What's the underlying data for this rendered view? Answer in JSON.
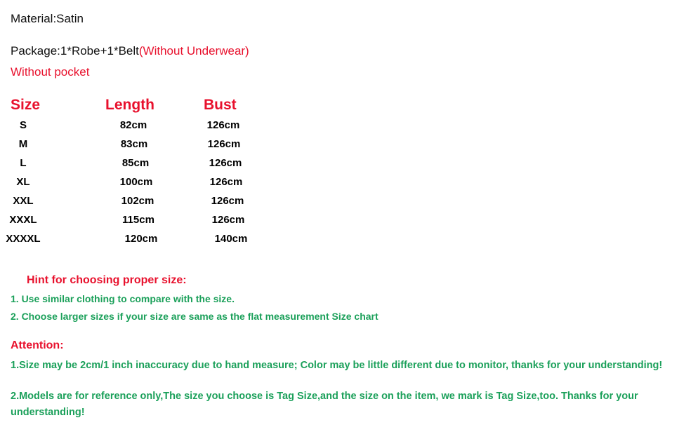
{
  "product_info": {
    "material_label": "Material:",
    "material_value": "Satin",
    "material_line": "Material:Satin",
    "package_main": "Package:1*Robe+1*Belt",
    "package_note": "(Without Underwear)",
    "pocket_note": "Without pocket"
  },
  "size_chart": {
    "headers": {
      "size": "Size",
      "length": "Length",
      "bust": "Bust"
    },
    "rows": [
      {
        "size": "S",
        "length": "82cm",
        "bust": "126cm"
      },
      {
        "size": "M",
        "length": "83cm",
        "bust": "126cm"
      },
      {
        "size": "L",
        "length": "85cm",
        "bust": "126cm"
      },
      {
        "size": "XL",
        "length": "100cm",
        "bust": "126cm"
      },
      {
        "size": "XXL",
        "length": "102cm",
        "bust": "126cm"
      },
      {
        "size": "XXXL",
        "length": "115cm",
        "bust": "126cm"
      },
      {
        "size": "XXXXL",
        "length": "120cm",
        "bust": "140cm"
      }
    ]
  },
  "hint": {
    "title": "Hint for choosing proper size:",
    "items": [
      "1. Use similar clothing to compare with the size.",
      "2. Choose larger sizes if your size are same as the flat measurement Size chart"
    ]
  },
  "attention": {
    "title": "Attention:",
    "items": [
      "1.Size may be 2cm/1 inch inaccuracy due to hand measure; Color may be little different   due to monitor, thanks for your understanding!",
      "2.Models are for reference only,The size you choose is Tag Size,and the size on the item,  we mark is Tag Size,too. Thanks for your understanding!"
    ]
  },
  "colors": {
    "red": "#e8112d",
    "green": "#1ba05a",
    "text": "#111111",
    "background": "#ffffff"
  }
}
